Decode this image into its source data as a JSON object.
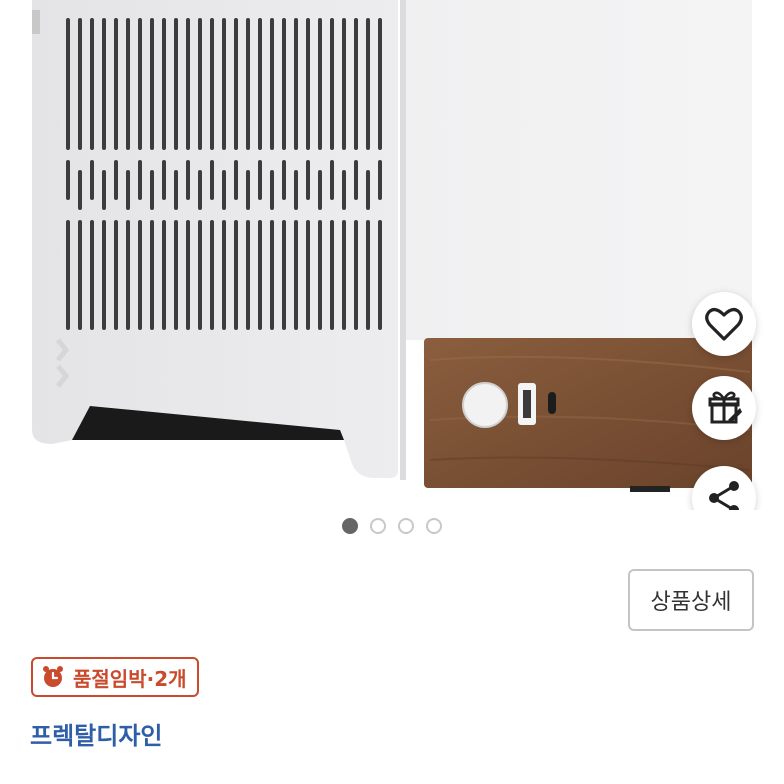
{
  "product_image": {
    "alt": "PC case with walnut front panel"
  },
  "actions": {
    "favorite_icon": "heart-icon",
    "gift_icon": "gift-icon",
    "share_icon": "share-icon"
  },
  "carousel": {
    "total": 4,
    "active_index": 0
  },
  "detail_button": {
    "label": "상품상세"
  },
  "stock_badge": {
    "icon": "alarm-clock-icon",
    "label": "품절임박·2개",
    "color": "#c94a2c"
  },
  "brand": {
    "name": "프렉탈디자인",
    "color": "#2f5ea8"
  }
}
